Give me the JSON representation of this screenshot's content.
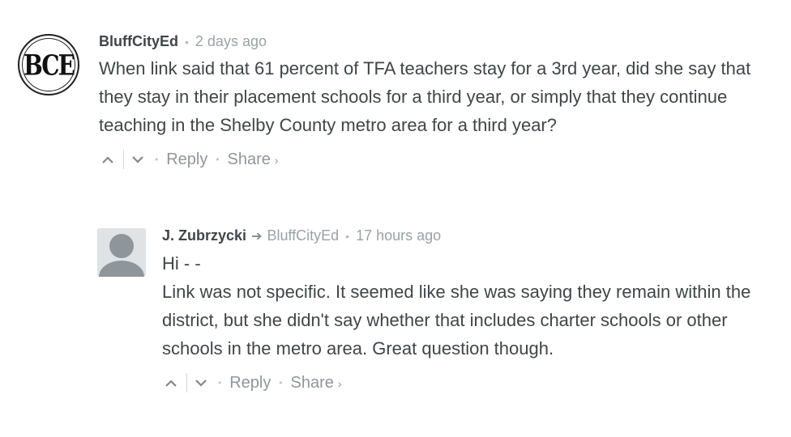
{
  "comments": [
    {
      "avatar_text": "BCE",
      "author": "BluffCityEd",
      "time": "2 days ago",
      "body": [
        "When link said that 61 percent of TFA teachers stay for a 3rd year, did she say that they stay in their placement schools for a third year, or simply that they continue teaching in the Shelby County metro area for a third year?"
      ],
      "actions": {
        "reply": "Reply",
        "share": "Share",
        "share_caret": "›"
      }
    },
    {
      "author": "J. Zubrzycki",
      "reply_to": "BluffCityEd",
      "time": "17 hours ago",
      "body": [
        "Hi - -",
        "Link was not specific. It seemed like she was saying they remain within the district, but she didn't say whether that includes charter schools or other schools in the metro area. Great question though."
      ],
      "actions": {
        "reply": "Reply",
        "share": "Share",
        "share_caret": "›"
      }
    }
  ],
  "icons": {
    "upvote": "chevron-up-icon",
    "downvote": "chevron-down-icon",
    "reply_arrow": "arrow-right-icon"
  }
}
